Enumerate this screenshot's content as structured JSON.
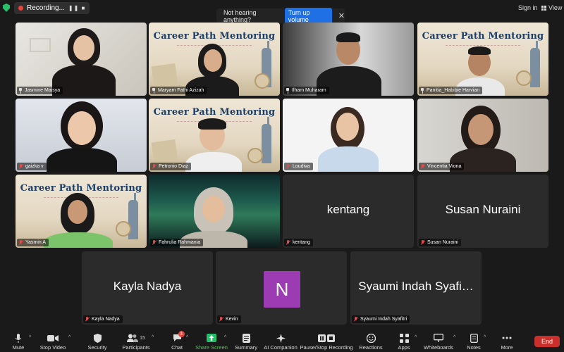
{
  "topbar": {
    "recording_label": "Recording...",
    "recording_controls": "❚❚ ■",
    "notice_text": "Not hearing anything?",
    "notice_button": "Turn up volume",
    "notice_close": "✕",
    "sign_in": "Sign in",
    "view": "View"
  },
  "banner": {
    "title": "Career Path Mentoring"
  },
  "participants": [
    {
      "name": "Jasmine Maisya",
      "status": "pinned"
    },
    {
      "name": "Maryam Fathi Azizah",
      "status": "pinned"
    },
    {
      "name": "Ilham Muharam",
      "status": "pinned"
    },
    {
      "name": "Panitia_Habibie Harvian",
      "status": "pinned"
    },
    {
      "name": "gaizka v",
      "status": "muted"
    },
    {
      "name": "Petronio Diaz",
      "status": "muted"
    },
    {
      "name": "Loudiva",
      "status": "muted"
    },
    {
      "name": "Vincentia Viona",
      "status": "muted"
    },
    {
      "name": "Yasmin A",
      "status": "muted"
    },
    {
      "name": "Fahrulia Rahmania",
      "status": "muted"
    },
    {
      "name": "kentang",
      "big": "kentang",
      "status": "muted"
    },
    {
      "name": "Susan Nuraini",
      "big": "Susan Nuraini",
      "status": "muted"
    },
    {
      "name": "Kayla Nadya",
      "big": "Kayla Nadya",
      "status": "muted"
    },
    {
      "name": "Kevin",
      "avatar": "N",
      "status": "muted"
    },
    {
      "name": "Syaumi Indah Syafitri",
      "big": "Syaumi Indah Syafi…",
      "status": "muted"
    }
  ],
  "toolbar": {
    "mute": "Mute",
    "stop_video": "Stop Video",
    "security": "Security",
    "participants": "Participants",
    "participants_count": "15",
    "chat": "Chat",
    "chat_badge": "3",
    "share_screen": "Share Screen",
    "summary": "Summary",
    "ai_companion": "AI Companion",
    "pause_stop_recording": "Pause/Stop Recording",
    "reactions": "Reactions",
    "apps": "Apps",
    "whiteboards": "Whiteboards",
    "notes": "Notes",
    "more": "More",
    "end": "End"
  },
  "colors": {
    "accent": "#1f6fe5",
    "end": "#c9302c",
    "active_speaker": "#3fd34a",
    "share": "#27c06a",
    "avatar": "#9b3cb3"
  }
}
